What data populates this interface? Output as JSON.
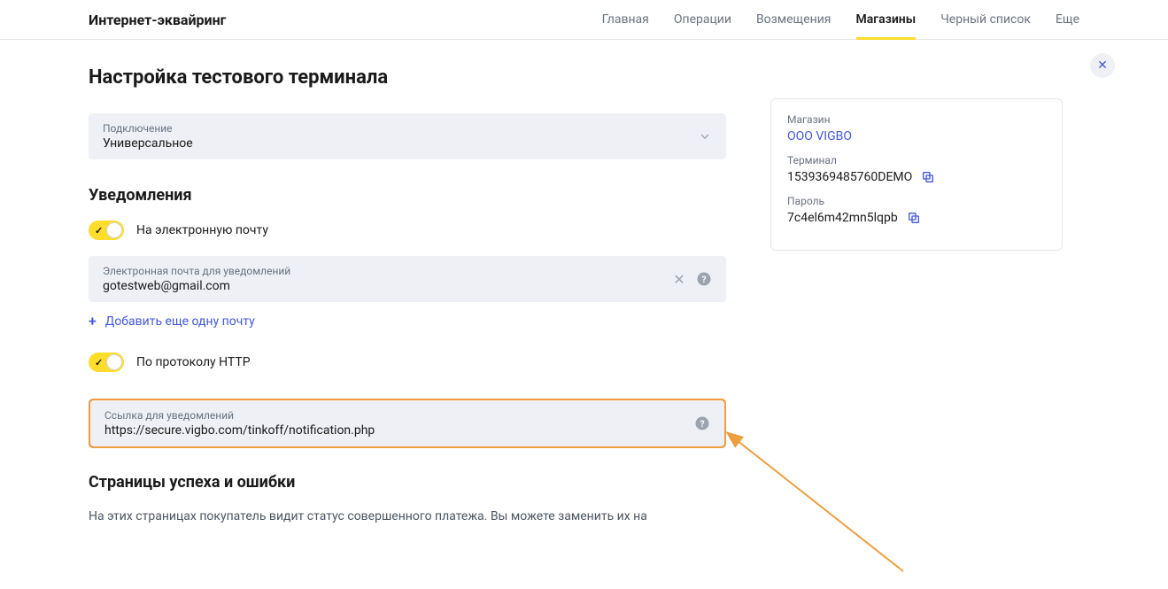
{
  "header": {
    "title": "Интернет-эквайринг",
    "nav": [
      "Главная",
      "Операции",
      "Возмещения",
      "Магазины",
      "Черный список",
      "Еще"
    ],
    "activeIndex": 3
  },
  "page": {
    "title": "Настройка тестового терминала"
  },
  "connection": {
    "label": "Подключение",
    "value": "Универсальное"
  },
  "notifications": {
    "title": "Уведомления",
    "emailToggle": {
      "label": "На электронную почту"
    },
    "emailField": {
      "label": "Электронная почта для уведомлений",
      "value": "gotestweb@gmail.com"
    },
    "addEmail": "Добавить еще одну почту",
    "httpToggle": {
      "label": "По протоколу HTTP"
    },
    "urlField": {
      "label": "Ссылка для уведомлений",
      "value": "https://secure.vigbo.com/tinkoff/notification.php"
    }
  },
  "pages": {
    "title": "Страницы успеха и ошибки",
    "desc": "На этих страницах покупатель видит статус совершенного платежа. Вы можете заменить их на"
  },
  "store": {
    "shopLabel": "Магазин",
    "shopName": "ООО VIGBO",
    "terminalLabel": "Терминал",
    "terminalValue": "1539369485760DEMO",
    "passwordLabel": "Пароль",
    "passwordValue": "7c4el6m42mn5lqpb"
  },
  "colors": {
    "accent": "#ffdd2d",
    "link": "#4258d6",
    "highlight": "#EE9E3E"
  }
}
